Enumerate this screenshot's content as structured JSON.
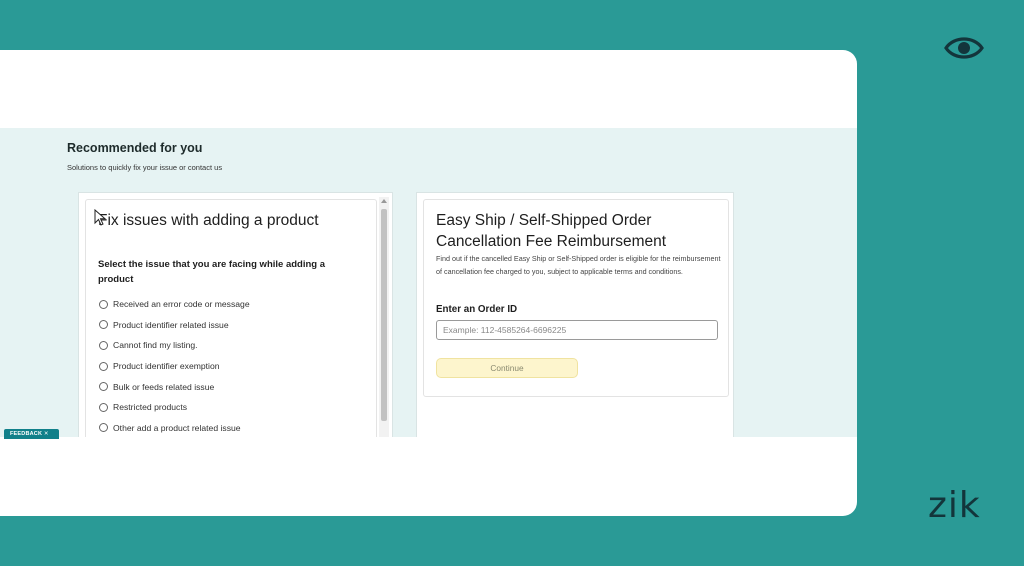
{
  "overlay": {
    "brand": "zik",
    "eye_icon": "eye-icon",
    "background_color": "#2a9a96"
  },
  "section": {
    "title": "Recommended for you",
    "subtitle": "Solutions to quickly fix your issue or contact us"
  },
  "left_card": {
    "title": "Fix issues with adding a product",
    "question": "Select the issue that you are facing while adding a product",
    "options": [
      "Received an error code or message",
      "Product identifier related issue",
      "Cannot find my listing.",
      "Product identifier exemption",
      "Bulk or feeds related issue",
      "Restricted products",
      "Other add a product related issue"
    ]
  },
  "right_card": {
    "title": "Easy Ship / Self-Shipped Order Cancellation Fee Reimbursement",
    "description": "Find out if the cancelled Easy Ship or Self-Shipped order is eligible for the reimbursement of cancellation fee charged to you, subject to applicable terms and conditions.",
    "order_label": "Enter an Order ID",
    "order_placeholder": "Example: 112-4585264-6696225",
    "continue_label": "Continue",
    "continue_color": "#fdf5cd"
  },
  "feedback": {
    "label": "FEEDBACK ✕"
  }
}
